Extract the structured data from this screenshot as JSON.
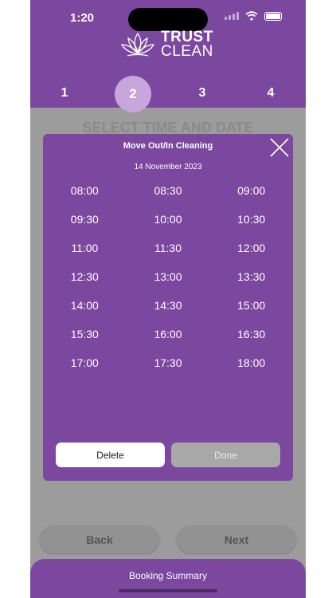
{
  "status_bar": {
    "time": "1:20"
  },
  "brand": {
    "line1": "TRUST",
    "line2": "CLEAN"
  },
  "steps": {
    "s1": "1",
    "s2": "2",
    "s3": "3",
    "s4": "4",
    "active": 2
  },
  "background": {
    "title": "SELECT TIME AND DATE"
  },
  "modal": {
    "title": "Move Out/In Cleaning",
    "date": "14 November 2023",
    "slots": [
      "08:00",
      "08:30",
      "09:00",
      "09:30",
      "10:00",
      "10:30",
      "11:00",
      "11:30",
      "12:00",
      "12:30",
      "13:00",
      "13:30",
      "14:00",
      "14:30",
      "15:00",
      "15:30",
      "16:00",
      "16:30",
      "17:00",
      "17:30",
      "18:00"
    ],
    "delete_label": "Delete",
    "done_label": "Done"
  },
  "nav": {
    "back_label": "Back",
    "next_label": "Next"
  },
  "summary": {
    "label": "Booking Summary"
  },
  "colors": {
    "brand_purple": "#7b479f",
    "active_step": "#c7a6dc",
    "overlay_gray": "#9c9c9c"
  }
}
